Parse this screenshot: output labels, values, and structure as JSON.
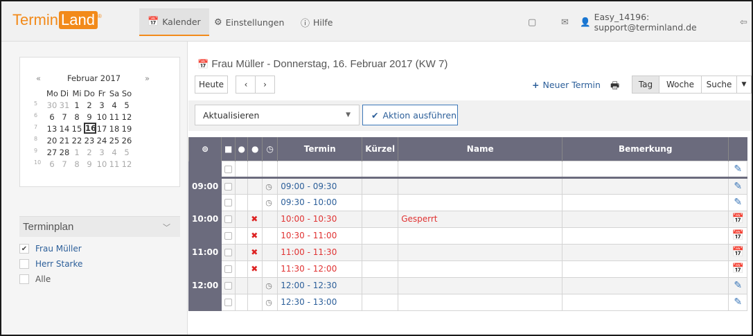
{
  "logo": {
    "part1": "Termin",
    "part2": "Land",
    "mark": "®"
  },
  "nav": [
    {
      "label": "Kalender",
      "icon": "calendar-icon"
    },
    {
      "label": "Einstellungen",
      "icon": "gear-icon"
    },
    {
      "label": "Hilfe",
      "icon": "help-icon"
    }
  ],
  "account": {
    "label": "Easy_14196: support@terminland.de"
  },
  "calendar": {
    "prev": "«",
    "next": "»",
    "month": "Februar 2017",
    "weekdays": [
      "Mo",
      "Di",
      "Mi",
      "Do",
      "Fr",
      "Sa",
      "So"
    ],
    "weeks": [
      {
        "wk": "5",
        "days": [
          "30",
          "31",
          "1",
          "2",
          "3",
          "4",
          "5"
        ],
        "other": [
          0,
          1
        ]
      },
      {
        "wk": "6",
        "days": [
          "6",
          "7",
          "8",
          "9",
          "10",
          "11",
          "12"
        ],
        "other": []
      },
      {
        "wk": "7",
        "days": [
          "13",
          "14",
          "15",
          "16",
          "17",
          "18",
          "19"
        ],
        "other": [],
        "today": 3
      },
      {
        "wk": "8",
        "days": [
          "20",
          "21",
          "22",
          "23",
          "24",
          "25",
          "26"
        ],
        "other": []
      },
      {
        "wk": "9",
        "days": [
          "27",
          "28",
          "1",
          "2",
          "3",
          "4",
          "5"
        ],
        "other": [
          2,
          3,
          4,
          5,
          6
        ]
      },
      {
        "wk": "10",
        "days": [
          "6",
          "7",
          "8",
          "9",
          "10",
          "11",
          "12"
        ],
        "other": [
          0,
          1,
          2,
          3,
          4,
          5,
          6
        ]
      }
    ]
  },
  "terminplan": {
    "title": "Terminplan",
    "items": [
      {
        "label": "Frau Müller",
        "checked": true
      },
      {
        "label": "Herr Starke",
        "checked": false
      },
      {
        "label": "Alle",
        "checked": false
      }
    ]
  },
  "main": {
    "title": "Frau Müller - Donnerstag, 16. Februar 2017 (KW 7)",
    "today_btn": "Heute",
    "new_appt": "Neuer Termin",
    "views": [
      "Tag",
      "Woche",
      "Suche"
    ],
    "action_select": "Aktualisieren",
    "action_btn": "Aktion ausführen"
  },
  "table": {
    "headers": [
      "Termin",
      "Kürzel",
      "Name",
      "Bemerkung"
    ],
    "rows": [
      {
        "time": "",
        "slot": "",
        "name": "",
        "blocked": false,
        "clock": false,
        "icon": "edit",
        "sep": false
      },
      {
        "time": "09:00",
        "slot": "09:00 - 09:30",
        "name": "",
        "blocked": false,
        "clock": true,
        "icon": "edit",
        "sep": true
      },
      {
        "time": "",
        "slot": "09:30 - 10:00",
        "name": "",
        "blocked": false,
        "clock": true,
        "icon": "edit",
        "sep": false
      },
      {
        "time": "10:00",
        "slot": "10:00 - 10:30",
        "name": "Gesperrt",
        "blocked": true,
        "clock": false,
        "icon": "cal",
        "sep": false
      },
      {
        "time": "",
        "slot": "10:30 - 11:00",
        "name": "",
        "blocked": true,
        "clock": false,
        "icon": "cal",
        "sep": false
      },
      {
        "time": "11:00",
        "slot": "11:00 - 11:30",
        "name": "",
        "blocked": true,
        "clock": false,
        "icon": "cal",
        "sep": false
      },
      {
        "time": "",
        "slot": "11:30 - 12:00",
        "name": "",
        "blocked": true,
        "clock": false,
        "icon": "cal",
        "sep": false
      },
      {
        "time": "12:00",
        "slot": "12:00 - 12:30",
        "name": "",
        "blocked": false,
        "clock": true,
        "icon": "edit",
        "sep": false
      },
      {
        "time": "",
        "slot": "12:30 - 13:00",
        "name": "",
        "blocked": false,
        "clock": true,
        "icon": "edit",
        "sep": false
      }
    ]
  },
  "colors": {
    "brand": "#f28a1a",
    "header": "#6b6b7d",
    "link": "#2b5e99",
    "blocked": "#e03232"
  }
}
